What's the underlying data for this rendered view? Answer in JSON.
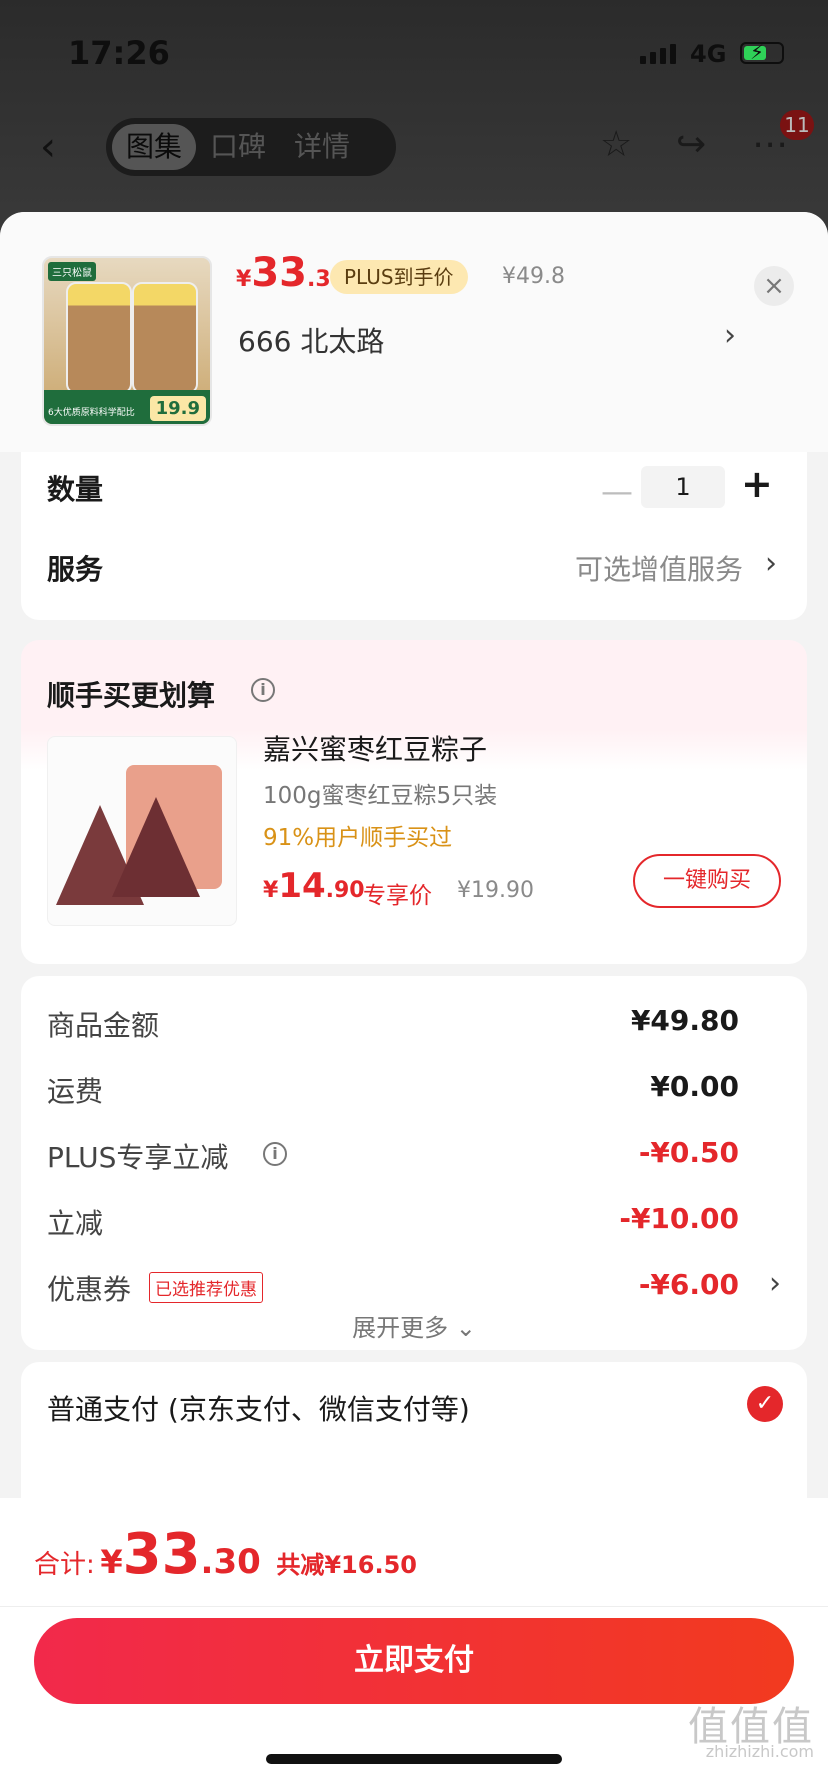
{
  "status_bar": {
    "time": "17:26",
    "network": "4G"
  },
  "nav": {
    "tabs": [
      {
        "label": "图集",
        "active": true
      },
      {
        "label": "口碑"
      },
      {
        "label": "详情"
      }
    ],
    "notification_count": "11"
  },
  "product": {
    "price_yen": "¥",
    "price_int": "33",
    "price_dec": ".3",
    "plus_tag": "PLUS到手价",
    "original_price": "¥49.8",
    "address": "666  北太路",
    "image_brand": "三只松鼠",
    "image_promo": "6大优质原料科学配比",
    "image_price": "19.9"
  },
  "quantity": {
    "label": "数量",
    "value": "1"
  },
  "service": {
    "label": "服务",
    "value": "可选增值服务"
  },
  "addon": {
    "title": "顺手买更划算",
    "name": "嘉兴蜜枣红豆粽子",
    "desc": "100g蜜枣红豆粽5只装",
    "buyers": "91%用户顺手买过",
    "price_yen": "¥",
    "price_int": "14",
    "price_dec": ".90",
    "price_tag": "专享价",
    "original_price": "¥19.90",
    "buy_label": "一键购买"
  },
  "fees": [
    {
      "label": "商品金额",
      "value": "¥49.80"
    },
    {
      "label": "运费",
      "value": "¥0.00"
    },
    {
      "label": "PLUS专享立减",
      "value": "-¥0.50"
    },
    {
      "label": "立减",
      "value": "-¥10.00"
    },
    {
      "label": "优惠券",
      "value": "-¥6.00",
      "tag": "已选推荐优惠"
    }
  ],
  "expand_label": "展开更多",
  "payment": {
    "method": "普通支付 (京东支付、微信支付等)"
  },
  "total": {
    "label": "合计:",
    "yen": "¥",
    "int": "33",
    "dec": ".30",
    "saved": "共减¥16.50"
  },
  "pay_button": "立即支付",
  "watermark": {
    "cn": "值值值",
    "en": "zhizhizhi.com"
  },
  "colors": {
    "accent": "#e4272b",
    "plus_tag_bg": "#fde8b1",
    "addon_highlight": "#d99217"
  }
}
